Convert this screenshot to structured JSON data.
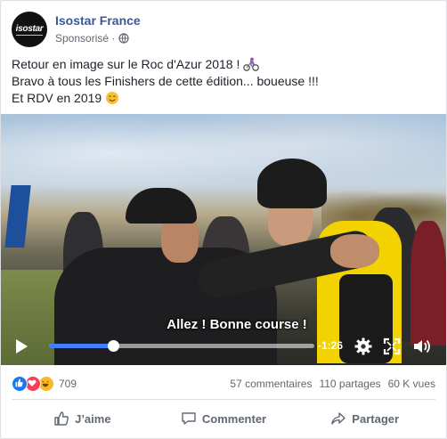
{
  "post": {
    "page_name": "Isostar France",
    "avatar_text": "isostar",
    "sponsored_label": "Sponsorisé ·",
    "text_lines": [
      "Retour en image sur le Roc d'Azur 2018 !",
      "Bravo à tous les Finishers de cette édition... boueuse !!!",
      "Et RDV en 2019"
    ]
  },
  "video": {
    "subtitle": "Allez ! Bonne course !",
    "time_remaining": "-1:26",
    "progress_fraction": 0.24,
    "accent_color": "#4080ff"
  },
  "stats": {
    "reaction_count": "709",
    "comments": "57 commentaires",
    "shares": "110 partages",
    "views": "60 K vues"
  },
  "actions": {
    "like": "J’aime",
    "comment": "Commenter",
    "share": "Partager"
  },
  "icons": [
    "globe-icon",
    "cyclist-emoji",
    "smile-emoji",
    "play-icon",
    "settings-icon",
    "fullscreen-icon",
    "volume-icon",
    "like-icon",
    "comment-icon",
    "share-icon"
  ]
}
